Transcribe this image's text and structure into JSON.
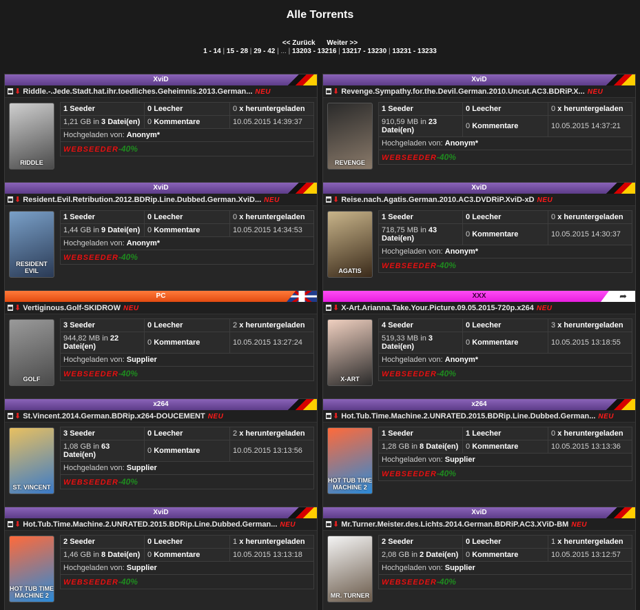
{
  "page": {
    "title": "Alle Torrents",
    "nav_back": "<< Zurück",
    "nav_next": "Weiter >>",
    "pages": [
      "1 - 14",
      "15 - 28",
      "29 - 42",
      "...",
      "13203 - 13216",
      "13217 - 13230",
      "13231 - 13233"
    ]
  },
  "labels": {
    "seeder": "Seeder",
    "leecher": "Leecher",
    "downloaded": "x heruntergeladen",
    "comments": "Kommentare",
    "uploaded_by": "Hochgeladen von:",
    "new_badge": "NEU",
    "webseeder": "WEBSEEDER",
    "webseeder_pct": "-40%"
  },
  "colors": {
    "xvid_bar": "#6e4a9e",
    "pc_bar": "#f25a1e",
    "xxx_bar": "#f030ea",
    "new_badge": "#ff1a1a",
    "webseeder": "#e01616",
    "webseeder_pct": "#1f8a1f"
  },
  "torrents": [
    {
      "category": "XviD",
      "flag": "de-flag",
      "name": "Riddle.-.Jede.Stadt.hat.ihr.toedliches.Geheimnis.2013.German...",
      "poster": "RIDDLE",
      "seeders": "1",
      "leechers": "0",
      "downloads": "0",
      "size": "1,21 GB in",
      "files": "3 Datei(en)",
      "comments": "0",
      "date": "10.05.2015 14:39:37",
      "uploader": "Anonym*"
    },
    {
      "category": "XviD",
      "flag": "de-flag",
      "name": "Revenge.Sympathy.for.the.Devil.German.2010.Uncut.AC3.BDRiP.X...",
      "poster": "REVENGE",
      "seeders": "1",
      "leechers": "0",
      "downloads": "0",
      "size": "910,59 MB in",
      "files": "23 Datei(en)",
      "comments": "0",
      "date": "10.05.2015 14:37:21",
      "uploader": "Anonym*"
    },
    {
      "category": "XviD",
      "flag": "de-flag",
      "name": "Resident.Evil.Retribution.2012.BDRip.Line.Dubbed.German.XviD...",
      "poster": "RESIDENT EVIL",
      "seeders": "1",
      "leechers": "0",
      "downloads": "0",
      "size": "1,44 GB in",
      "files": "9 Datei(en)",
      "comments": "0",
      "date": "10.05.2015 14:34:53",
      "uploader": "Anonym*"
    },
    {
      "category": "XviD",
      "flag": "de-flag",
      "name": "Reise.nach.Agatis.German.2010.AC3.DVDRiP.XviD-xD",
      "poster": "AGATIS",
      "seeders": "1",
      "leechers": "0",
      "downloads": "0",
      "size": "718,75 MB in",
      "files": "43 Datei(en)",
      "comments": "0",
      "date": "10.05.2015 14:30:37",
      "uploader": "Anonym*"
    },
    {
      "category": "PC",
      "flag": "uk-flag",
      "name": "Vertiginous.Golf-SKIDROW",
      "poster": "GOLF",
      "seeders": "3",
      "leechers": "0",
      "downloads": "2",
      "size": "944,82 MB in",
      "files": "22 Datei(en)",
      "comments": "0",
      "date": "10.05.2015 13:27:24",
      "uploader": "Supplier"
    },
    {
      "category": "XXX",
      "flag": "xxx-flag",
      "name": "X-Art.Arianna.Take.Your.Picture.09.05.2015-720p.x264",
      "poster": "X-ART",
      "seeders": "4",
      "leechers": "0",
      "downloads": "3",
      "size": "519,33 MB in",
      "files": "3 Datei(en)",
      "comments": "0",
      "date": "10.05.2015 13:18:55",
      "uploader": "Anonym*"
    },
    {
      "category": "x264",
      "flag": "de-flag",
      "name": "St.Vincent.2014.German.BDRip.x264-DOUCEMENT",
      "poster": "ST. VINCENT",
      "seeders": "3",
      "leechers": "0",
      "downloads": "2",
      "size": "1,08 GB in",
      "files": "63 Datei(en)",
      "comments": "0",
      "date": "10.05.2015 13:13:56",
      "uploader": "Supplier"
    },
    {
      "category": "x264",
      "flag": "de-flag",
      "name": "Hot.Tub.Time.Machine.2.UNRATED.2015.BDRip.Line.Dubbed.German...",
      "poster": "HOT TUB TIME MACHINE 2",
      "seeders": "1",
      "leechers": "1",
      "downloads": "0",
      "size": "1,28 GB in",
      "files": "8 Datei(en)",
      "comments": "0",
      "date": "10.05.2015 13:13:36",
      "uploader": "Supplier"
    },
    {
      "category": "XviD",
      "flag": "de-flag",
      "name": "Hot.Tub.Time.Machine.2.UNRATED.2015.BDRip.Line.Dubbed.German...",
      "poster": "HOT TUB TIME MACHINE 2",
      "seeders": "2",
      "leechers": "0",
      "downloads": "1",
      "size": "1,46 GB in",
      "files": "8 Datei(en)",
      "comments": "0",
      "date": "10.05.2015 13:13:18",
      "uploader": "Supplier"
    },
    {
      "category": "XviD",
      "flag": "de-flag",
      "name": "Mr.Turner.Meister.des.Lichts.2014.German.BDRiP.AC3.XViD-BM",
      "poster": "MR. TURNER",
      "seeders": "2",
      "leechers": "0",
      "downloads": "1",
      "size": "2,08 GB in",
      "files": "2 Datei(en)",
      "comments": "0",
      "date": "10.05.2015 13:12:57",
      "uploader": "Supplier"
    }
  ]
}
